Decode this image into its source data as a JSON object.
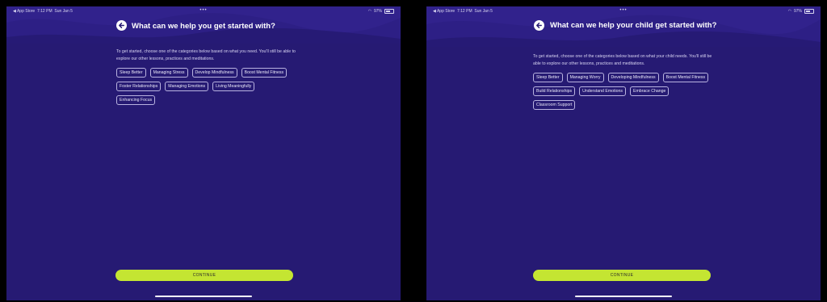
{
  "colors": {
    "background": "#261a73",
    "accent": "#c4e532",
    "chip_border": "#b9b3e0"
  },
  "left_screen": {
    "status_bar": {
      "back_app": "◀ App Store",
      "time": "7:12 PM",
      "date": "Sun Jan 5",
      "battery": "97%"
    },
    "title": "What can we help you get started with?",
    "intro": "To get started, choose one of the categories below based on what you need. You'll still be able to explore our other lessons, practices and meditations.",
    "chips": [
      "Sleep Better",
      "Managing Stress",
      "Develop Mindfulness",
      "Boost Mental Fitness",
      "Foster Relationships",
      "Managing Emotions",
      "Living Meaningfully",
      "Enhancing Focus"
    ],
    "continue_label": "CONTINUE",
    "icons": {
      "back": "arrow-left-icon"
    }
  },
  "right_screen": {
    "status_bar": {
      "back_app": "◀ App Store",
      "time": "7:12 PM",
      "date": "Sun Jan 5",
      "battery": "97%"
    },
    "title": "What can we help your child get started with?",
    "intro": "To get started, choose one of the categories below based on what your child needs. You'll still be able to explore our other lessons, practices and meditations.",
    "chips": [
      "Sleep Better",
      "Managing Worry",
      "Developing Mindfulness",
      "Boost Mental Fitness",
      "Build Relationships",
      "Understand Emotions",
      "Embrace Change",
      "Classroom Support"
    ],
    "continue_label": "CONTINUE",
    "icons": {
      "back": "arrow-left-icon"
    }
  }
}
